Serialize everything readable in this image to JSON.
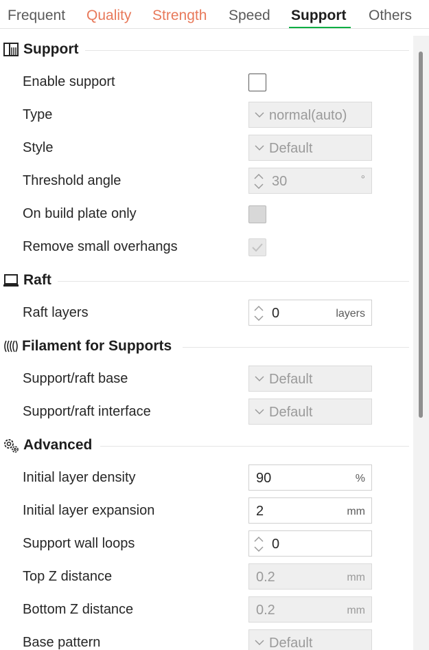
{
  "tabs": [
    {
      "label": "Frequent",
      "state": "normal"
    },
    {
      "label": "Quality",
      "state": "modified"
    },
    {
      "label": "Strength",
      "state": "modified"
    },
    {
      "label": "Speed",
      "state": "normal"
    },
    {
      "label": "Support",
      "state": "active"
    },
    {
      "label": "Others",
      "state": "normal"
    }
  ],
  "colors": {
    "accent": "#00ae42",
    "modified_tab": "#e8795a",
    "disabled_field": "#efefef"
  },
  "sections": {
    "support": {
      "title": "Support",
      "icon": "support-icon",
      "enable_support": {
        "label": "Enable support",
        "checked": false
      },
      "type": {
        "label": "Type",
        "value": "normal(auto)"
      },
      "style": {
        "label": "Style",
        "value": "Default"
      },
      "threshold_angle": {
        "label": "Threshold angle",
        "value": "30",
        "unit": "°"
      },
      "on_build_plate_only": {
        "label": "On build plate only",
        "checked": false
      },
      "remove_small_overhangs": {
        "label": "Remove small overhangs",
        "checked": true
      }
    },
    "raft": {
      "title": "Raft",
      "icon": "raft-icon",
      "raft_layers": {
        "label": "Raft layers",
        "value": "0",
        "unit": "layers"
      }
    },
    "filament": {
      "title": "Filament for Supports",
      "icon": "filament-icon",
      "base": {
        "label": "Support/raft base",
        "value": "Default"
      },
      "interface": {
        "label": "Support/raft interface",
        "value": "Default"
      }
    },
    "advanced": {
      "title": "Advanced",
      "icon": "gear-icon",
      "initial_layer_density": {
        "label": "Initial layer density",
        "value": "90",
        "unit": "%"
      },
      "initial_layer_expansion": {
        "label": "Initial layer expansion",
        "value": "2",
        "unit": "mm"
      },
      "support_wall_loops": {
        "label": "Support wall loops",
        "value": "0"
      },
      "top_z_distance": {
        "label": "Top Z distance",
        "value": "0.2",
        "unit": "mm"
      },
      "bottom_z_distance": {
        "label": "Bottom Z distance",
        "value": "0.2",
        "unit": "mm"
      },
      "base_pattern": {
        "label": "Base pattern",
        "value": "Default"
      }
    }
  }
}
